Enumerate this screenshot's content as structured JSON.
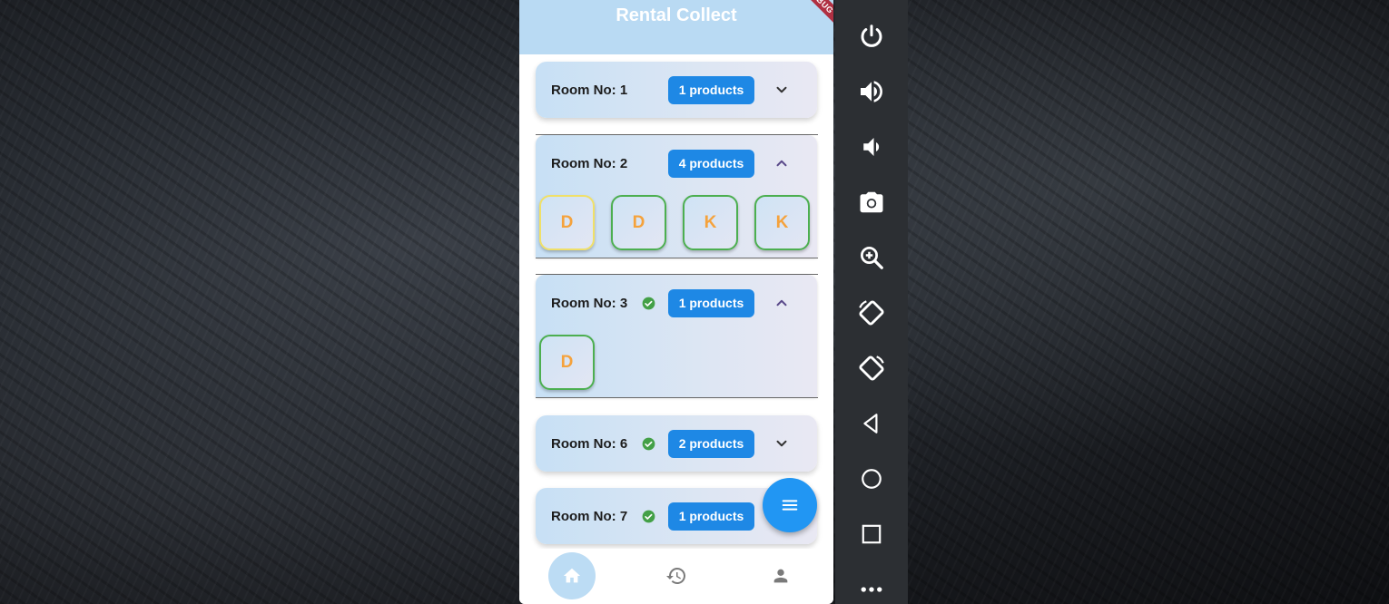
{
  "app": {
    "title": "Rental Collect",
    "debug_banner": "DEBUG"
  },
  "rooms": [
    {
      "label": "Room No: 1",
      "badge": "1 products",
      "paid": false,
      "expanded": false,
      "products": []
    },
    {
      "label": "Room No: 2",
      "badge": "4 products",
      "paid": false,
      "expanded": true,
      "products": [
        "D",
        "D",
        "K",
        "K"
      ]
    },
    {
      "label": "Room No: 3",
      "badge": "1 products",
      "paid": true,
      "expanded": true,
      "products": [
        "D"
      ]
    },
    {
      "label": "Room No: 6",
      "badge": "2 products",
      "paid": true,
      "expanded": false,
      "products": []
    },
    {
      "label": "Room No: 7",
      "badge": "1 products",
      "paid": true,
      "expanded": false,
      "products": []
    }
  ],
  "bottom_nav": {
    "items": [
      "home-icon",
      "history-icon",
      "person-icon"
    ],
    "active": "home-icon"
  },
  "fab": {
    "icon": "menu-icon"
  },
  "emulator_controls": [
    "power-icon",
    "volume-up-icon",
    "volume-down-icon",
    "camera-icon",
    "zoom-in-icon",
    "rotate-left-icon",
    "rotate-right-icon",
    "back-icon",
    "home-circle-icon",
    "overview-icon",
    "more-icon"
  ],
  "colors": {
    "appbar": "#b9daf3",
    "badge": "#1e88e5",
    "check": "#43a047",
    "chip_border": "#4caf50",
    "chip_selected_border": "#f0e068",
    "chip_text": "#f5a23c",
    "fab": "#2196f3",
    "nav_active": "#bcdcf4",
    "emulator_bar": "#2c2f33"
  }
}
